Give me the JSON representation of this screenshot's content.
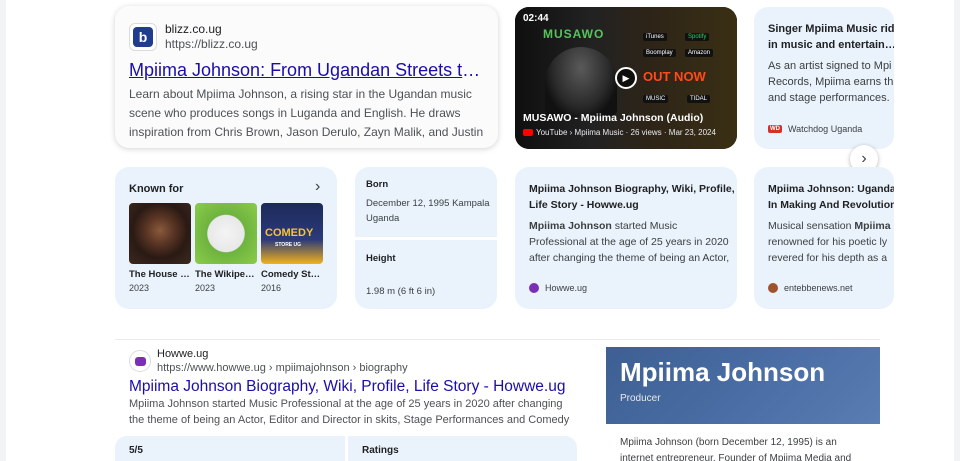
{
  "result1": {
    "site_name": "blizz.co.ug",
    "site_url": "https://blizz.co.ug",
    "title": "Mpiima Johnson: From Ugandan Streets to…",
    "snippet": "Learn about Mpiima Johnson, a rising star in the Ugandan music scene who produces songs in Luganda and English. He draws inspiration from Chris Brown, Jason Derulo, Zayn Malik, and Justin Bieber and aims to achieve international…"
  },
  "video": {
    "duration": "02:44",
    "art_text": "MUSAWO",
    "out_now": "OUT NOW",
    "platforms": [
      "iTunes",
      "Spotify",
      "Boomplay",
      "Amazon",
      "MUSIC",
      "TIDAL"
    ],
    "title": "MUSAWO - Mpiima Johnson (Audio)",
    "meta": "YouTube › Mpiima Music · 26 views · Mar 23, 2024"
  },
  "watchdog_card": {
    "title": "Singer Mpiima Music ridin… in music and entertain…",
    "title_line1": "Singer Mpiima Music ridin",
    "title_line2": "in music and entertain…",
    "snippet_line1": "As an artist signed to Mpi",
    "snippet_line2": "Records, Mpiima earns th",
    "snippet_line3": "and stage performances.",
    "source": "Watchdog Uganda",
    "source_badge": "WD"
  },
  "known_for": {
    "label": "Known for",
    "items": [
      {
        "label": "The House …",
        "year": "2023"
      },
      {
        "label": "The Wikipe…",
        "year": "2023"
      },
      {
        "label": "Comedy St…",
        "year": "2016"
      }
    ],
    "comedy_thumb_text": "COMEDY",
    "comedy_thumb_sub": "STORE UG"
  },
  "facts": {
    "born_label": "Born",
    "born_value_line1": "December 12, 1995 Kampala",
    "born_value_line2": "Uganda",
    "height_label": "Height",
    "height_value": "1.98 m (6 ft 6 in)"
  },
  "howwe_card": {
    "title_line1": "Mpiima Johnson Biography, Wiki, Profile,",
    "title_line2": "Life Story - Howwe.ug",
    "snippet_bold": "Mpiima Johnson",
    "snippet_rest1": " started Music",
    "snippet_line2": "Professional at the age of 25 years in 2020",
    "snippet_line3": "after changing the theme of being an Actor,",
    "source": "Howwe.ug"
  },
  "entebbe_card": {
    "title_line1": "Mpiima Johnson: Uganda",
    "title_line2": "In Making And Revolution",
    "snippet_pre": "Musical sensation ",
    "snippet_bold": "Mpiima",
    "snippet_line2": "renowned for his poetic ly",
    "snippet_line3": "revered for his depth as a",
    "source": "entebbenews.net"
  },
  "result2": {
    "site_name": "Howwe.ug",
    "site_url": "https://www.howwe.ug › mpiimajohnson › biography",
    "title": "Mpiima Johnson Biography, Wiki, Profile, Life Story - Howwe.ug",
    "snippet": "Mpiima Johnson started Music Professional at the age of 25 years in 2020 after changing the theme of being an Actor, Editor and Director in skits, Stage Performances and Comedy Videos. …"
  },
  "ratings": {
    "score": "5/5",
    "label": "Ratings"
  },
  "knowledge_panel": {
    "name": "Mpiima Johnson",
    "subtitle": "Producer",
    "description": "Mpiima Johnson (born December 12, 1995) is an internet entrepreneur. Founder of Mpiima Media and Mpiima Music"
  },
  "icons": {
    "next": "chevron-right-icon",
    "known_for_arrow": "chevron-right-icon",
    "play": "play-icon"
  }
}
